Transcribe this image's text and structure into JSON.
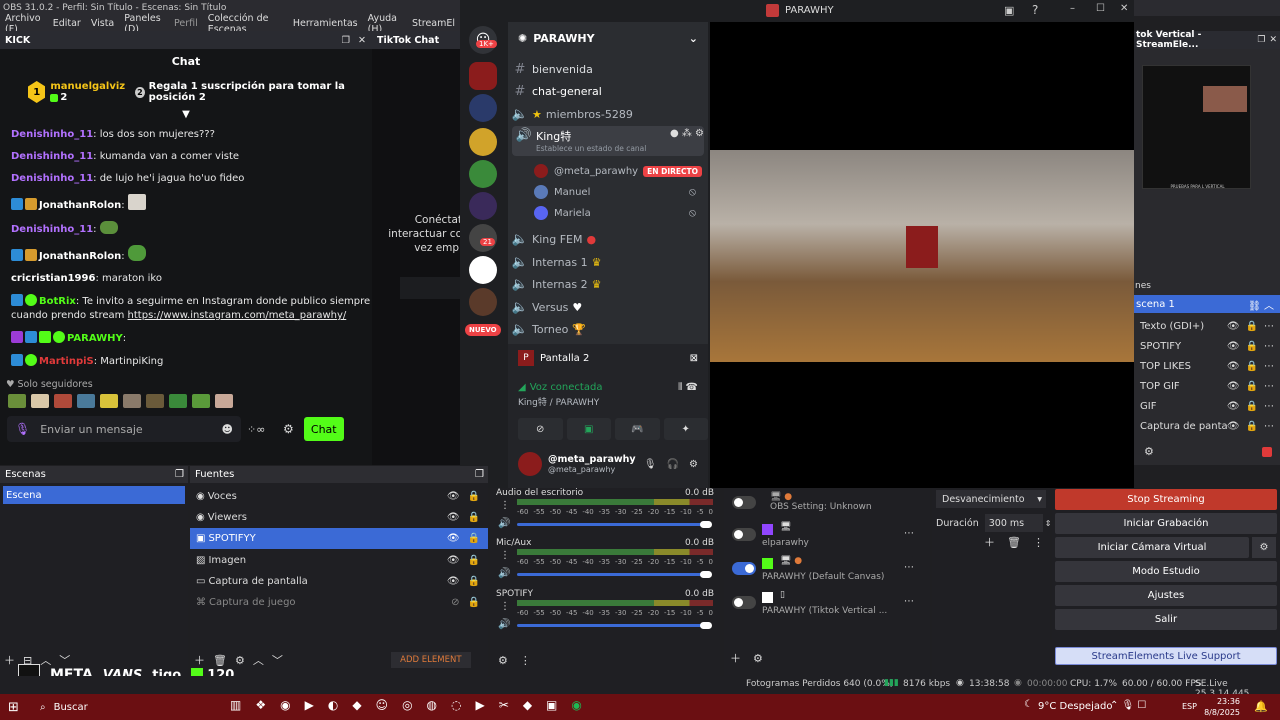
{
  "window": {
    "title": "OBS 31.0.2 - Perfil: Sin Título - Escenas: Sin Título"
  },
  "menu": [
    "Archivo (F)",
    "Editar",
    "Vista",
    "Paneles (D)",
    "Perfil",
    "Colección de Escenas",
    "Herramientas",
    "Ayuda (H)",
    "StreamEl"
  ],
  "kick": {
    "dock_title": "KICK",
    "chat_title": "Chat",
    "pinned": {
      "user": "manuelgalviz",
      "count": "2",
      "rank": "1",
      "text": "Regala 1 suscripción para tomar la posición 2",
      "rank2": "2"
    },
    "messages": [
      {
        "user": "Denishinho_11",
        "text": ": los dos son mujeres???"
      },
      {
        "user": "Denishinho_11",
        "text": ": kumanda van a comer viste"
      },
      {
        "user": "Denishinho_11",
        "text": ": de lujo he'i jagua ho'uo fideo"
      },
      {
        "user": "JonathanRolon",
        "text": ":"
      },
      {
        "user": "Denishinho_11",
        "text": ":"
      },
      {
        "user": "JonathanRolon",
        "text": ":"
      },
      {
        "user": "cricristian1996",
        "text": ": maraton iko"
      },
      {
        "user": "BotRix",
        "text": ": Te invito a seguirme en Instagram donde publico siempre",
        "line2": "cuando prendo stream ",
        "link": "https://www.instagram.com/meta_parawhy/"
      },
      {
        "user": "PARAWHY",
        "text": ":"
      },
      {
        "user": "MartinpiS",
        "text": ": MartinpiKing"
      }
    ],
    "followers_only": "Solo seguidores",
    "input_placeholder": "Enviar un mensaje",
    "send_button": "Chat"
  },
  "tiktok": {
    "dock_title": "TikTok Chat",
    "connect_text": [
      "Conéctat",
      "interactuar co",
      "vez empi"
    ]
  },
  "discord": {
    "window_title": "PARAWHY",
    "server_name": "PARAWHY",
    "server_badges": {
      "top": "1K+",
      "mid": "21",
      "new": "NUEVO"
    },
    "channels": [
      {
        "name": "bienvenida",
        "type": "text"
      },
      {
        "name": "chat-general",
        "type": "text"
      },
      {
        "name": "miembros-5289",
        "type": "voice"
      },
      {
        "name": "King特",
        "type": "voice",
        "status": "Establece un estado de canal"
      },
      {
        "name": "@meta_parawhy",
        "type": "member",
        "live": "EN DIRECTO"
      },
      {
        "name": "Manuel",
        "type": "member"
      },
      {
        "name": "Mariela",
        "type": "member"
      },
      {
        "name": "King FEM",
        "type": "voice"
      },
      {
        "name": "Internas 1",
        "type": "voice"
      },
      {
        "name": "Internas 2",
        "type": "voice"
      },
      {
        "name": "Versus",
        "type": "voice"
      },
      {
        "name": "Torneo",
        "type": "voice"
      }
    ],
    "screen_share": "Pantalla 2",
    "voice_status": "Voz conectada",
    "voice_channel": "King特 / PARAWHY",
    "user": {
      "name": "@meta_parawhy",
      "sub": "@meta_parawhy"
    }
  },
  "rightdock": {
    "title": "tok Vertical - StreamEle...",
    "preview_text": "PRUEBAS PARA L VERTICAL",
    "section": "nes",
    "scene": "scena 1",
    "sources": [
      "Texto (GDI+)",
      "SPOTIFY",
      "TOP LIKES",
      "TOP GIF",
      "GIF",
      "Captura de pantal"
    ]
  },
  "escenas": {
    "title": "Escenas",
    "items": [
      "Escena"
    ]
  },
  "fuentes": {
    "title": "Fuentes",
    "items": [
      "Voces",
      "Viewers",
      "SPOTIFYY",
      "Imagen",
      "Captura de pantalla",
      "Captura de juego"
    ],
    "add_element": "ADD ELEMENT"
  },
  "mixer": {
    "channels": [
      {
        "name": "Audio del escritorio",
        "db": "0.0 dB"
      },
      {
        "name": "Mic/Aux",
        "db": "0.0 dB"
      },
      {
        "name": "SPOTIFY",
        "db": "0.0 dB"
      }
    ],
    "ticks": [
      "-60",
      "-55",
      "-50",
      "-45",
      "-40",
      "-35",
      "-30",
      "-25",
      "-20",
      "-15",
      "-10",
      "-5",
      "0"
    ]
  },
  "transitions": {
    "obs_setting": "OBS Setting: Unknown",
    "items": [
      {
        "name": "elparawhy",
        "on": false
      },
      {
        "name": "PARAWHY (Default Canvas)",
        "on": true
      },
      {
        "name": "PARAWHY  (Tiktok Vertical ...",
        "on": false
      }
    ]
  },
  "transdur": {
    "transition": "Desvanecimiento",
    "label": "Duración",
    "value": "300 ms"
  },
  "controls": {
    "buttons": [
      "Stop Streaming",
      "Iniciar Grabación",
      "Iniciar Cámara Virtual",
      "Modo Estudio",
      "Ajustes",
      "Salir"
    ],
    "support": "StreamElements Live Support"
  },
  "status": {
    "frames": "Fotogramas Perdidos 640 (0.0%)",
    "kbps": "8176 kbps",
    "time": "13:38:58",
    "rec": "00:00:00",
    "cpu": "CPU: 1.7%",
    "fps": "60.00 / 60.00 FPS",
    "version": "SE.Live 25.3.14.445"
  },
  "sponsors": {
    "kick_count": "120",
    "logos": [
      "META",
      "VANS",
      "tigo"
    ]
  },
  "taskbar": {
    "search": "Buscar",
    "weather": "9°C  Despejado",
    "lang": "ESP",
    "clock": "23:36",
    "date": "8/8/2025"
  },
  "colors": {
    "kick_green": "#53fc18",
    "obs_blue": "#3b6ad6",
    "stop_red": "#c0392b",
    "discord_live": "#ed4245"
  }
}
